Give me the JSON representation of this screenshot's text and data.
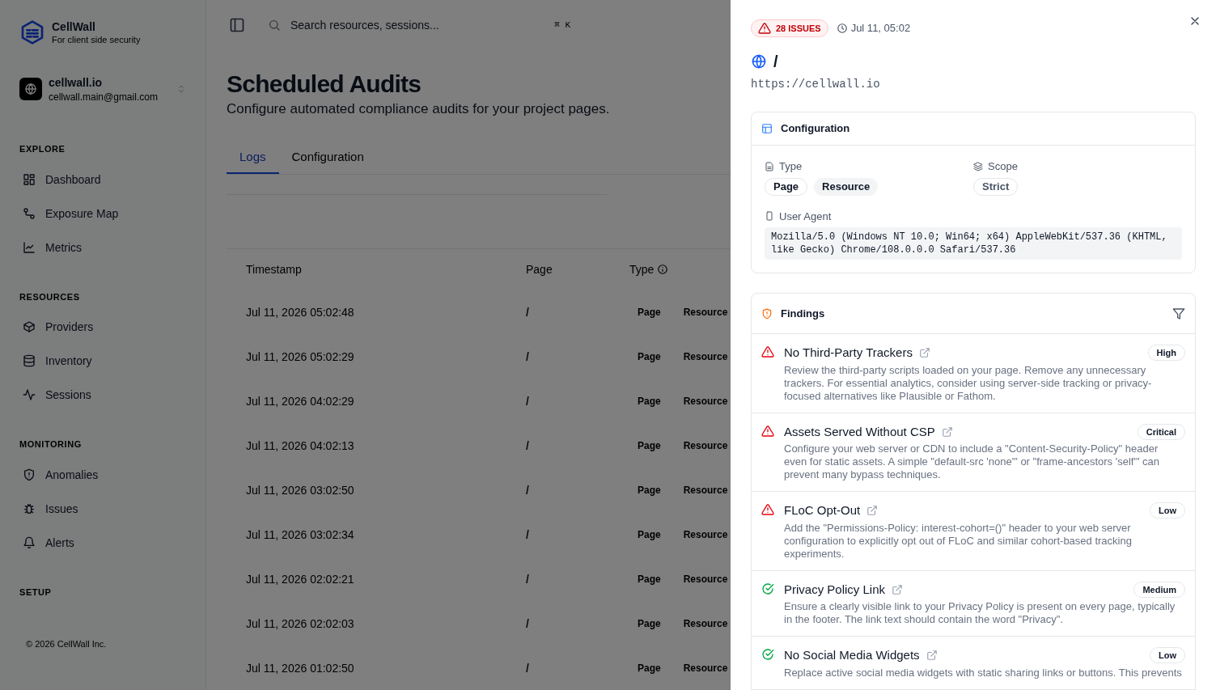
{
  "brand": {
    "name": "CellWall",
    "tagline": "For client side security"
  },
  "account": {
    "name": "cellwall.io",
    "email": "cellwall.main@gmail.com"
  },
  "sidebar": {
    "sections": [
      {
        "title": "EXPLORE",
        "items": [
          {
            "label": "Dashboard",
            "selected": false
          },
          {
            "label": "Exposure Map",
            "selected": false
          },
          {
            "label": "Metrics",
            "selected": false
          }
        ]
      },
      {
        "title": "RESOURCES",
        "items": [
          {
            "label": "Providers",
            "selected": false
          },
          {
            "label": "Inventory",
            "selected": false
          },
          {
            "label": "Sessions",
            "selected": false
          }
        ]
      },
      {
        "title": "MONITORING",
        "items": [
          {
            "label": "Anomalies",
            "selected": false
          },
          {
            "label": "Issues",
            "selected": false
          },
          {
            "label": "Alerts",
            "selected": false
          }
        ]
      },
      {
        "title": "SETUP"
      }
    ],
    "footer": "© 2026 CellWall Inc."
  },
  "search": {
    "placeholder": "Search resources, sessions...",
    "shortcut": "⌘ K"
  },
  "page": {
    "title": "Scheduled Audits",
    "subtitle": "Configure automated compliance audits for your project pages."
  },
  "tabs": [
    {
      "label": "Logs",
      "selected": true
    },
    {
      "label": "Configuration",
      "selected": false
    }
  ],
  "table": {
    "columns": [
      "Timestamp",
      "Page",
      "Type"
    ],
    "rows": [
      {
        "timestamp": "Jul 11, 2026 05:02:48",
        "page": "/",
        "types": [
          "Page",
          "Resource"
        ]
      },
      {
        "timestamp": "Jul 11, 2026 05:02:29",
        "page": "/",
        "types": [
          "Page",
          "Resource"
        ]
      },
      {
        "timestamp": "Jul 11, 2026 04:02:29",
        "page": "/",
        "types": [
          "Page",
          "Resource"
        ]
      },
      {
        "timestamp": "Jul 11, 2026 04:02:13",
        "page": "/",
        "types": [
          "Page",
          "Resource"
        ]
      },
      {
        "timestamp": "Jul 11, 2026 03:02:50",
        "page": "/",
        "types": [
          "Page",
          "Resource"
        ]
      },
      {
        "timestamp": "Jul 11, 2026 03:02:34",
        "page": "/",
        "types": [
          "Page",
          "Resource"
        ]
      },
      {
        "timestamp": "Jul 11, 2026 02:02:21",
        "page": "/",
        "types": [
          "Page",
          "Resource"
        ]
      },
      {
        "timestamp": "Jul 11, 2026 02:02:03",
        "page": "/",
        "types": [
          "Page",
          "Resource"
        ]
      },
      {
        "timestamp": "Jul 11, 2026 01:02:50",
        "page": "/",
        "types": [
          "Page",
          "Resource"
        ]
      }
    ]
  },
  "drawer": {
    "issues": "28 ISSUES",
    "time": "Jul 11, 05:02",
    "path": "/",
    "url": "https://cellwall.io",
    "configuration": {
      "title": "Configuration",
      "type_label": "Type",
      "types": [
        "Page",
        "Resource"
      ],
      "scope_label": "Scope",
      "scopes": [
        "Strict"
      ],
      "ua_label": "User Agent",
      "user_agent": "Mozilla/5.0 (Windows NT 10.0; Win64; x64) AppleWebKit/537.36 (KHTML, like Gecko) Chrome/108.0.0.0 Safari/537.36"
    },
    "findings": {
      "title": "Findings",
      "items": [
        {
          "kind": "failed",
          "title": "No Third-Party Trackers",
          "severity": "High",
          "description": "Review the third-party scripts loaded on your page. Remove any unnecessary trackers. For essential analytics, consider using server-side tracking or privacy-focused alternatives like Plausible or Fathom."
        },
        {
          "kind": "failed",
          "title": "Assets Served Without CSP",
          "severity": "Critical",
          "description": "Configure your web server or CDN to include a \"Content-Security-Policy\" header even for static assets. A simple \"default-src 'none'\" or \"frame-ancestors 'self'\" can prevent many bypass techniques."
        },
        {
          "kind": "failed",
          "title": "FLoC Opt-Out",
          "severity": "Low",
          "description": "Add the \"Permissions-Policy: interest-cohort=()\" header to your web server configuration to explicitly opt out of FLoC and similar cohort-based tracking experiments."
        },
        {
          "kind": "passed",
          "title": "Privacy Policy Link",
          "severity": "Medium",
          "description": "Ensure a clearly visible link to your Privacy Policy is present on every page, typically in the footer. The link text should contain the word \"Privacy\"."
        },
        {
          "kind": "passed",
          "title": "No Social Media Widgets",
          "severity": "Low",
          "description": "Replace active social media widgets with static sharing links or buttons. This prevents"
        }
      ]
    }
  }
}
